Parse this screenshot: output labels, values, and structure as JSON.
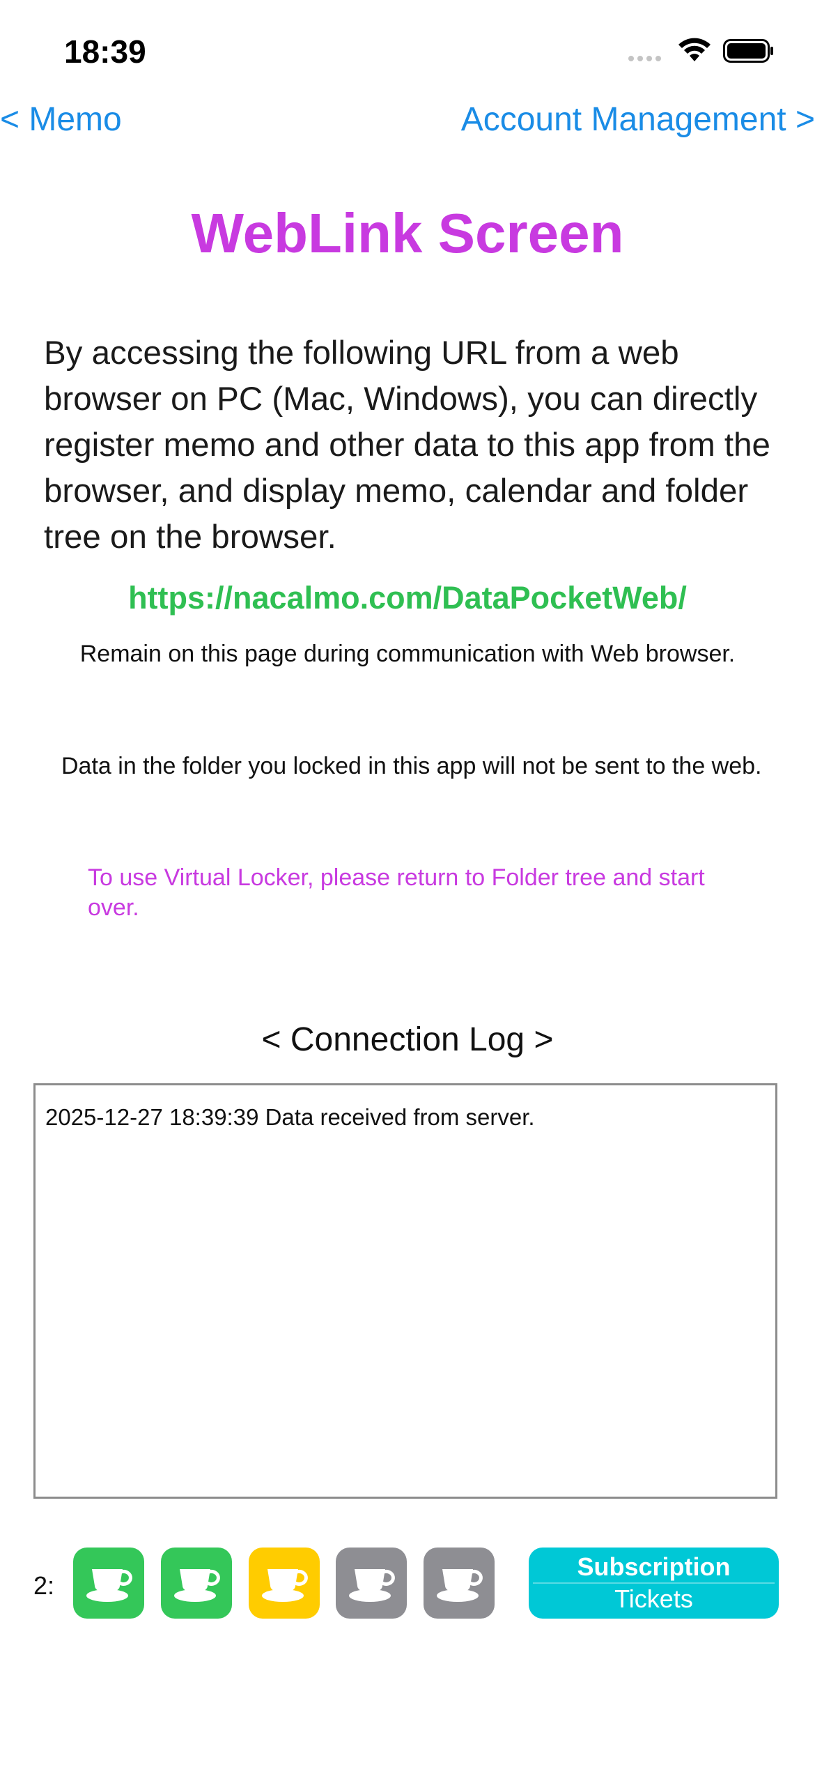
{
  "status_bar": {
    "time": "18:39"
  },
  "nav": {
    "back_label": "<  Memo",
    "forward_label": "Account Management  >"
  },
  "page": {
    "title": "WebLink Screen",
    "description": "By accessing the following URL from a web browser on PC (Mac, Windows), you can directly register memo and other data to this app from the browser, and display memo, calendar and folder tree on the browser.",
    "url": "https://nacalmo.com/DataPocketWeb/",
    "remain_note": "Remain on this page during communication with Web browser.",
    "lock_note": "Data in the folder you locked in this app will not be sent to the web.",
    "locker_note": "To use Virtual Locker, please return to Folder tree and start over."
  },
  "log": {
    "title": "< Connection Log >",
    "entries": [
      "2025-12-27 18:39:39 Data received from server."
    ]
  },
  "tickets": {
    "count_label": "2:",
    "cups": [
      {
        "icon": "coffee-cup-icon",
        "color": "#34c759"
      },
      {
        "icon": "coffee-cup-icon",
        "color": "#34c759"
      },
      {
        "icon": "coffee-cup-icon",
        "color": "#ffcc00"
      },
      {
        "icon": "coffee-cup-icon",
        "color": "#8e8e93"
      },
      {
        "icon": "coffee-cup-icon",
        "color": "#8e8e93"
      }
    ],
    "subscription_line1": "Subscription",
    "subscription_line2": "Tickets"
  },
  "colors": {
    "link_blue": "#1a8ce6",
    "accent_magenta": "#c83ae0",
    "url_green": "#2fbf52",
    "subscription_cyan": "#00c8d6"
  }
}
